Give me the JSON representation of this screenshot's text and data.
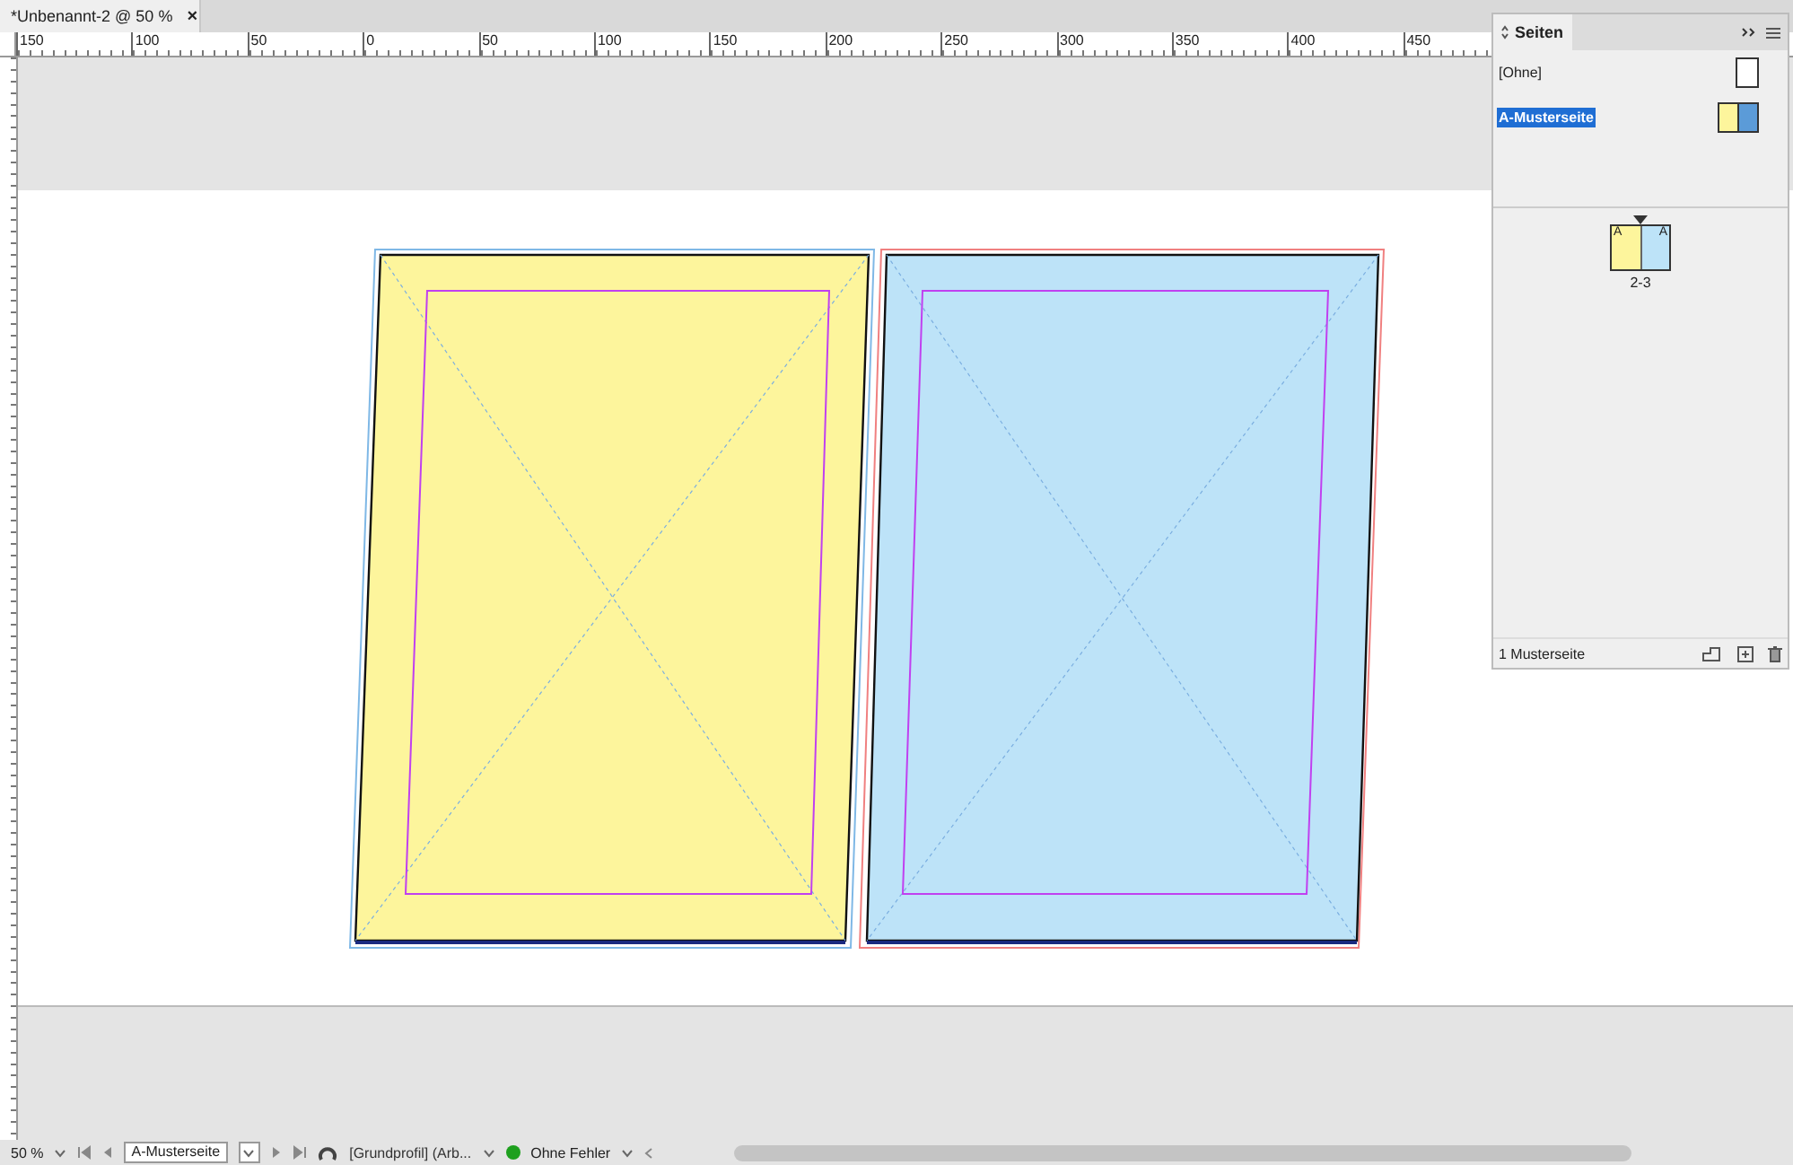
{
  "document_tab": {
    "title": "*Unbenannt-2 @ 50 %",
    "close": "×"
  },
  "ruler": {
    "labels": [
      "150",
      "100",
      "50",
      "0",
      "50",
      "100",
      "150",
      "200",
      "250",
      "300",
      "350",
      "400",
      "450"
    ]
  },
  "spread": {
    "pages": [
      {
        "color": "#fdf59c"
      },
      {
        "color": "#bde3f8"
      }
    ]
  },
  "pages_panel": {
    "title": "Seiten",
    "masters": [
      {
        "label": "[Ohne]",
        "selected": false,
        "kind": "blank"
      },
      {
        "label": "A-Musterseite",
        "selected": true,
        "kind": "spread"
      }
    ],
    "spreads": [
      {
        "pages": [
          {
            "prefix": "A",
            "color": "#fdf59c"
          },
          {
            "prefix": "A",
            "color": "#bde3f8"
          }
        ],
        "label": "2-3"
      }
    ],
    "footer": "1 Musterseite"
  },
  "status_bar": {
    "zoom": "50 %",
    "page": "A-Musterseite",
    "profile": "[Grundprofil] (Arb...",
    "preflight": {
      "label": "Ohne Fehler",
      "color": "#1ea01e"
    }
  }
}
